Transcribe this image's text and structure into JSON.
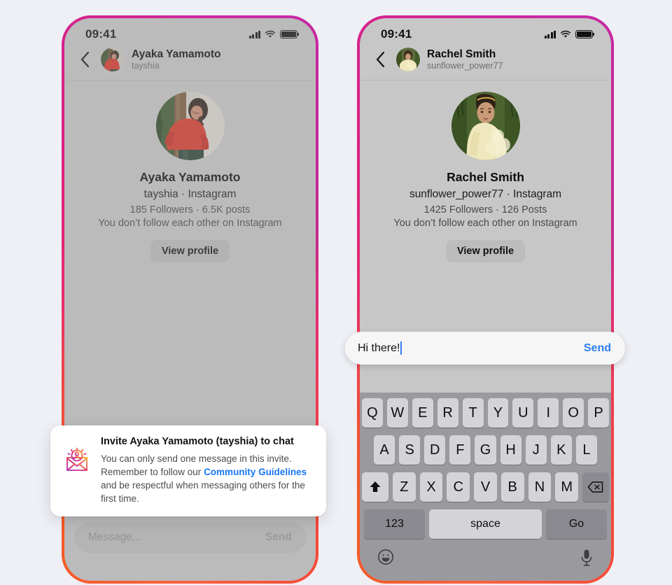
{
  "page": {
    "background_color": "#eef0f5",
    "screen_background": "#c7c7c7",
    "accent_blue": "#2d7ff0",
    "link_blue": "#1877f2"
  },
  "left_phone": {
    "status_bar": {
      "time": "09:41",
      "signal_icon": "cellular-signal-icon",
      "wifi_icon": "wifi-icon",
      "battery_icon": "battery-icon"
    },
    "nav": {
      "back_icon": "chevron-left-icon",
      "avatar": "avatar",
      "name": "Ayaka Yamamoto",
      "handle": "tayshia"
    },
    "profile": {
      "avatar": "profile-avatar",
      "name": "Ayaka Yamamoto",
      "subtitle": "tayshia · Instagram",
      "stats": "185 Followers · 6.5K posts",
      "relationship": "You don’t follow each other on Instagram",
      "view_profile_label": "View profile"
    },
    "message_bar": {
      "placeholder": "Message...",
      "send_label": "Send"
    }
  },
  "invite_card": {
    "icon": "invite-envelope-icon",
    "title": "Invite Ayaka Yamamoto (tayshia) to chat",
    "body_part1": "You can only send one message in this invite. Remember to follow our ",
    "link_label": "Community Guidelines",
    "body_part2": " and be respectful when messaging others for the first time."
  },
  "right_phone": {
    "status_bar": {
      "time": "09:41",
      "signal_icon": "cellular-signal-icon",
      "wifi_icon": "wifi-icon",
      "battery_icon": "battery-icon"
    },
    "nav": {
      "back_icon": "chevron-left-icon",
      "avatar": "avatar",
      "name": "Rachel Smith",
      "handle": "sunflower_power77"
    },
    "profile": {
      "avatar": "profile-avatar",
      "name": "Rachel Smith",
      "subtitle": "sunflower_power77 · Instagram",
      "stats": "1425 Followers · 126 Posts",
      "relationship": "You don’t follow each other on Instagram",
      "view_profile_label": "View profile"
    },
    "input": {
      "value": "Hi there!",
      "send_label": "Send"
    },
    "keyboard": {
      "row1": [
        "Q",
        "W",
        "E",
        "R",
        "T",
        "Y",
        "U",
        "I",
        "O",
        "P"
      ],
      "row2": [
        "A",
        "S",
        "D",
        "F",
        "G",
        "H",
        "J",
        "K",
        "L"
      ],
      "row3_letters": [
        "Z",
        "X",
        "C",
        "V",
        "B",
        "N",
        "M"
      ],
      "shift_icon": "shift-arrow-icon",
      "backspace_icon": "backspace-icon",
      "numbers_label": "123",
      "space_label": "space",
      "go_label": "Go",
      "emoji_icon": "emoji-smiley-icon",
      "mic_icon": "microphone-icon"
    }
  }
}
